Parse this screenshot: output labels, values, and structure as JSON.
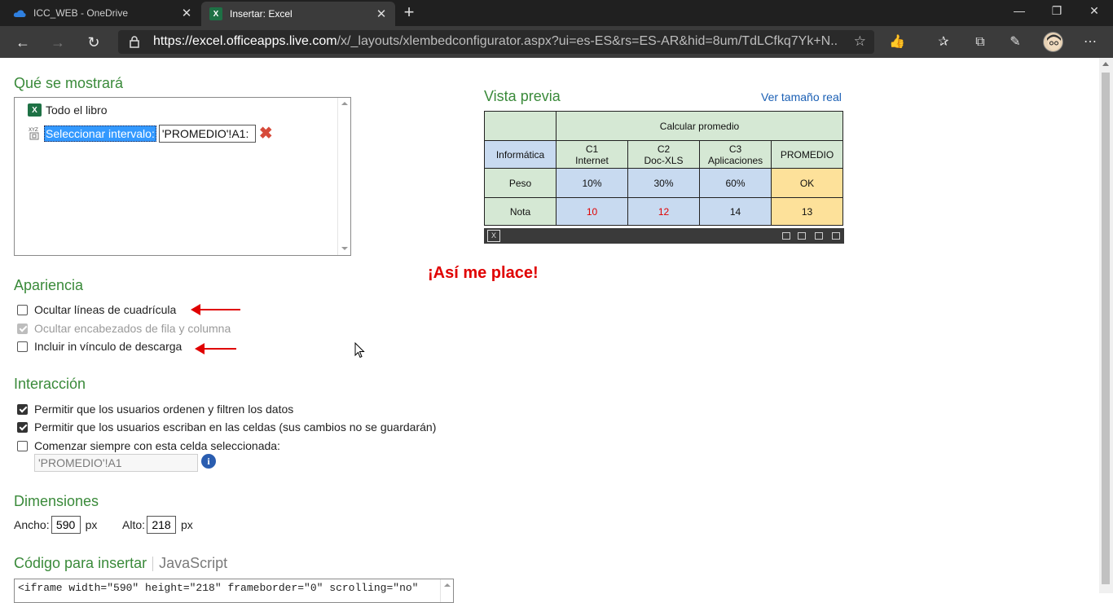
{
  "browser": {
    "tabs": [
      {
        "label": "ICC_WEB - OneDrive",
        "icon": "onedrive-icon"
      },
      {
        "label": "Insertar: Excel",
        "icon": "excel-icon",
        "active": true
      }
    ],
    "url_host": "https://excel.officeapps.live.com",
    "url_path": "/x/_layouts/xlembedconfigurator.aspx?ui=es-ES&rs=ES-AR&hid=8um/TdLCfkq7Yk+N..."
  },
  "display": {
    "heading": "Qué se mostrará",
    "whole_book": "Todo el libro",
    "select_range": "Seleccionar intervalo:",
    "range_value": "'PROMEDIO'!A1:"
  },
  "appearance": {
    "heading": "Apariencia",
    "options": [
      {
        "label": "Ocultar líneas de cuadrícula",
        "checked": false,
        "disabled": false
      },
      {
        "label": "Ocultar encabezados de fila y columna",
        "checked": true,
        "disabled": true
      },
      {
        "label": "Incluir in vínculo de descarga",
        "checked": false,
        "disabled": false
      }
    ]
  },
  "annotation": "¡Así me place!",
  "interaction": {
    "heading": "Interacción",
    "options": [
      {
        "label": "Permitir que los usuarios ordenen y filtren los datos",
        "checked": true
      },
      {
        "label": "Permitir que los usuarios escriban en las celdas (sus cambios no se guardarán)",
        "checked": true
      },
      {
        "label": "Comenzar siempre con esta celda seleccionada:",
        "checked": false
      }
    ],
    "cell_value": "'PROMEDIO'!A1"
  },
  "dimensions": {
    "heading": "Dimensiones",
    "width_label": "Ancho:",
    "width_value": "590",
    "height_label": "Alto:",
    "height_value": "218",
    "unit": "px"
  },
  "code": {
    "heading": "Código para insertar",
    "js_link": "JavaScript",
    "snippet": "<iframe width=\"590\" height=\"218\" frameborder=\"0\" scrolling=\"no\""
  },
  "preview": {
    "heading": "Vista previa",
    "link": "Ver tamaño real",
    "table": {
      "title": "Calcular promedio",
      "row_header": "Informática",
      "columns": [
        "C1\nInternet",
        "C2\nDoc-XLS",
        "C3\nAplicaciones",
        "PROMEDIO"
      ],
      "rows": [
        {
          "label": "Peso",
          "values": [
            "10%",
            "30%",
            "60%",
            "OK"
          ]
        },
        {
          "label": "Nota",
          "values": [
            "10",
            "12",
            "14",
            "13"
          ]
        }
      ]
    }
  }
}
